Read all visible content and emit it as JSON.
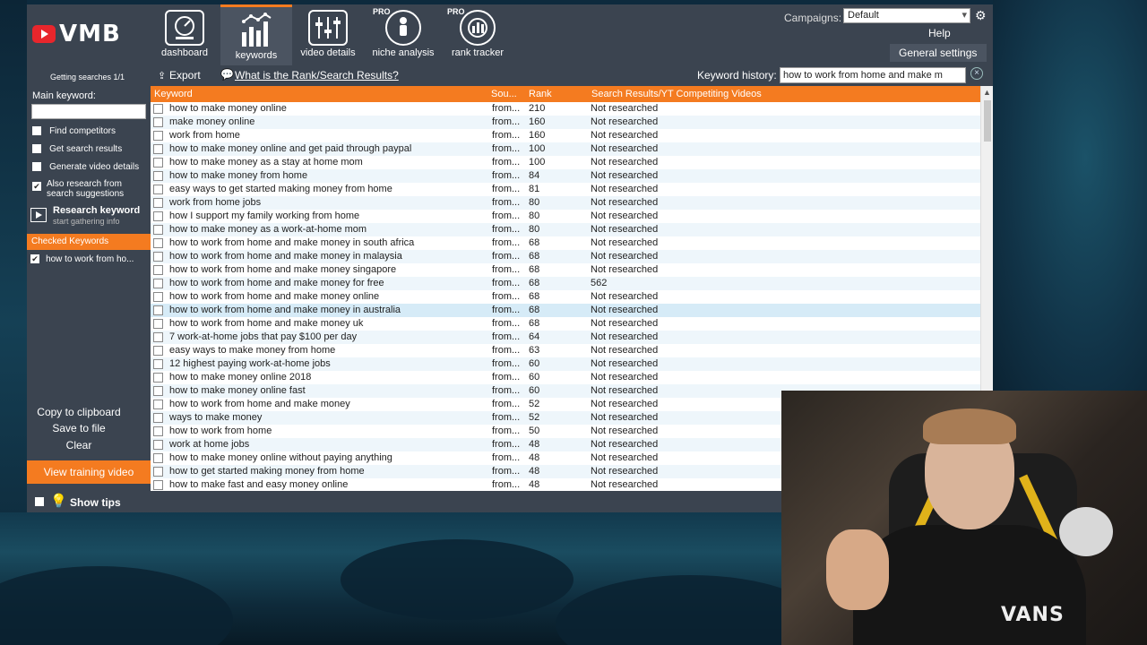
{
  "brand": {
    "name": "VMB"
  },
  "nav": [
    {
      "id": "dashboard",
      "label": "dashboard",
      "pro": ""
    },
    {
      "id": "keywords",
      "label": "keywords",
      "pro": ""
    },
    {
      "id": "video_details",
      "label": "video details",
      "pro": ""
    },
    {
      "id": "niche_analysis",
      "label": "niche analysis",
      "pro": "PRO"
    },
    {
      "id": "rank_tracker",
      "label": "rank tracker",
      "pro": "PRO"
    }
  ],
  "campaigns": {
    "label": "Campaigns:",
    "value": "Default"
  },
  "header_links": {
    "help": "Help",
    "general_settings": "General settings"
  },
  "sidebar": {
    "getting_searches": "Getting searches 1/1",
    "main_keyword_label": "Main keyword:",
    "main_keyword_value": "",
    "options": [
      {
        "label": "Find competitors",
        "checked": false
      },
      {
        "label": "Get search results",
        "checked": false
      },
      {
        "label": "Generate video details",
        "checked": false
      },
      {
        "label": "Also research from search suggestions",
        "checked": true
      }
    ],
    "research_title": "Research keyword",
    "research_sub": "start gathering info",
    "checked_keywords_label": "Checked Keywords",
    "checked_keywords": [
      "how to work from ho..."
    ],
    "copy_clipboard": "Copy to clipboard",
    "save_file": "Save to file",
    "clear": "Clear",
    "training_video": "View training video"
  },
  "toolbar": {
    "export": "Export",
    "what_is": "What is the Rank/Search Results?",
    "history_label": "Keyword history:",
    "history_value": "how to work from home and make m"
  },
  "table": {
    "headers": {
      "keyword": "Keyword",
      "source": "Sou...",
      "rank": "Rank",
      "results": "Search Results/YT Competiting Videos"
    },
    "rows": [
      {
        "keyword": "how to make money online",
        "source": "from...",
        "rank": "210",
        "results": "Not researched"
      },
      {
        "keyword": "make money online",
        "source": "from...",
        "rank": "160",
        "results": "Not researched"
      },
      {
        "keyword": "work from home",
        "source": "from...",
        "rank": "160",
        "results": "Not researched"
      },
      {
        "keyword": "how to make money online and get paid through paypal",
        "source": "from...",
        "rank": "100",
        "results": "Not researched"
      },
      {
        "keyword": "how to make money as a stay at home mom",
        "source": "from...",
        "rank": "100",
        "results": "Not researched"
      },
      {
        "keyword": "how to make money from home",
        "source": "from...",
        "rank": "84",
        "results": "Not researched"
      },
      {
        "keyword": "easy ways to get started making money from home",
        "source": "from...",
        "rank": "81",
        "results": "Not researched"
      },
      {
        "keyword": "work from home jobs",
        "source": "from...",
        "rank": "80",
        "results": "Not researched"
      },
      {
        "keyword": "how I support my family working from home",
        "source": "from...",
        "rank": "80",
        "results": "Not researched"
      },
      {
        "keyword": "how to make money as a work-at-home mom",
        "source": "from...",
        "rank": "80",
        "results": "Not researched"
      },
      {
        "keyword": "how to work from home and make money in south africa",
        "source": "from...",
        "rank": "68",
        "results": "Not researched"
      },
      {
        "keyword": "how to work from home and make money in malaysia",
        "source": "from...",
        "rank": "68",
        "results": "Not researched"
      },
      {
        "keyword": "how to work from home and make money singapore",
        "source": "from...",
        "rank": "68",
        "results": "Not researched"
      },
      {
        "keyword": "how to work from home and make money for free",
        "source": "from...",
        "rank": "68",
        "results": "562"
      },
      {
        "keyword": "how to work from home and make money online",
        "source": "from...",
        "rank": "68",
        "results": "Not researched"
      },
      {
        "keyword": "how to work from home and make money in australia",
        "source": "from...",
        "rank": "68",
        "results": "Not researched"
      },
      {
        "keyword": "how to work from home and make money uk",
        "source": "from...",
        "rank": "68",
        "results": "Not researched"
      },
      {
        "keyword": "7 work-at-home jobs that pay $100 per day",
        "source": "from...",
        "rank": "64",
        "results": "Not researched"
      },
      {
        "keyword": "easy ways to make money from home",
        "source": "from...",
        "rank": "63",
        "results": "Not researched"
      },
      {
        "keyword": "12 highest paying work-at-home jobs",
        "source": "from...",
        "rank": "60",
        "results": "Not researched"
      },
      {
        "keyword": "how to make money online 2018",
        "source": "from...",
        "rank": "60",
        "results": "Not researched"
      },
      {
        "keyword": "how to make money online fast",
        "source": "from...",
        "rank": "60",
        "results": "Not researched"
      },
      {
        "keyword": "how to work from home and make money",
        "source": "from...",
        "rank": "52",
        "results": "Not researched"
      },
      {
        "keyword": "ways to make money",
        "source": "from...",
        "rank": "52",
        "results": "Not researched"
      },
      {
        "keyword": "how to work from home",
        "source": "from...",
        "rank": "50",
        "results": "Not researched"
      },
      {
        "keyword": "work at home jobs",
        "source": "from...",
        "rank": "48",
        "results": "Not researched"
      },
      {
        "keyword": "how to make money online without paying anything",
        "source": "from...",
        "rank": "48",
        "results": "Not researched"
      },
      {
        "keyword": "how to get started making money from home",
        "source": "from...",
        "rank": "48",
        "results": "Not researched"
      },
      {
        "keyword": "how to make fast and easy money online",
        "source": "from...",
        "rank": "48",
        "results": "Not researched"
      }
    ],
    "selected_row": 15
  },
  "bottombar": {
    "show_tips": "Show tips"
  },
  "webcam": {
    "shirt_text": "VANS"
  },
  "colors": {
    "accent": "#f47b20",
    "panel": "#3b4450",
    "logo_red": "#e8262c"
  }
}
